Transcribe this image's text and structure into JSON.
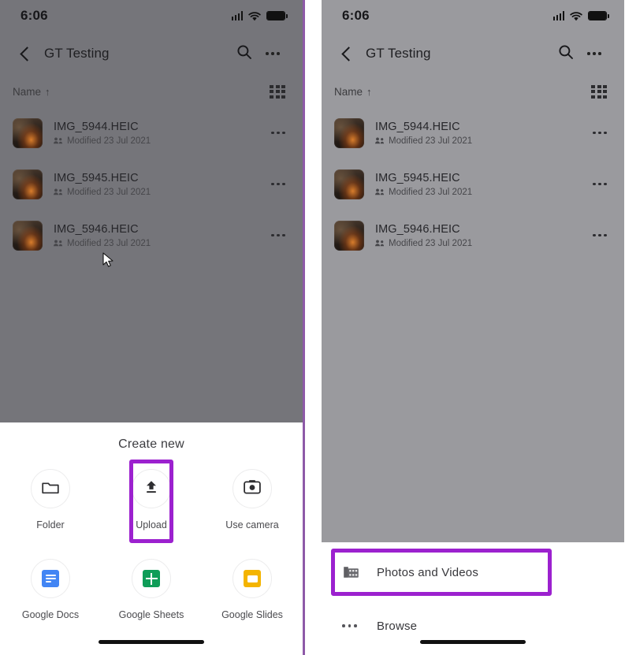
{
  "app": {
    "name": "Google Drive iOS"
  },
  "status_bar": {
    "time": "6:06",
    "icons": [
      "cellular-signal-icon",
      "wifi-icon",
      "battery-icon"
    ]
  },
  "app_bar": {
    "back_icon": "back-chevron-icon",
    "title": "GT Testing",
    "search_icon": "search-icon",
    "overflow_icon": "more-options-icon"
  },
  "sort_row": {
    "label": "Name",
    "direction_arrow": "↑",
    "view_toggle_icon": "grid-view-icon"
  },
  "files": [
    {
      "name": "IMG_5944.HEIC",
      "subtitle": "Modified 23 Jul 2021",
      "shared_icon": "shared-people-icon",
      "overflow_icon": "more-options-icon"
    },
    {
      "name": "IMG_5945.HEIC",
      "subtitle": "Modified 23 Jul 2021",
      "shared_icon": "shared-people-icon",
      "overflow_icon": "more-options-icon"
    },
    {
      "name": "IMG_5946.HEIC",
      "subtitle": "Modified 23 Jul 2021",
      "shared_icon": "shared-people-icon",
      "overflow_icon": "more-options-icon"
    }
  ],
  "left_panel": {
    "sheet": {
      "title": "Create new",
      "items": [
        {
          "label": "Folder",
          "icon": "folder-icon",
          "highlighted": false
        },
        {
          "label": "Upload",
          "icon": "upload-icon",
          "highlighted": true
        },
        {
          "label": "Use camera",
          "icon": "camera-icon",
          "highlighted": false
        },
        {
          "label": "Google Docs",
          "icon": "google-docs-icon",
          "highlighted": false
        },
        {
          "label": "Google Sheets",
          "icon": "google-sheets-icon",
          "highlighted": false
        },
        {
          "label": "Google Slides",
          "icon": "google-slides-icon",
          "highlighted": false
        }
      ]
    },
    "cursor": "mouse-pointer"
  },
  "right_panel": {
    "sheet": {
      "items": [
        {
          "label": "Photos and Videos",
          "icon": "photos-videos-icon",
          "highlighted": true
        },
        {
          "label": "Browse",
          "icon": "browse-dots-icon",
          "highlighted": false
        }
      ]
    }
  },
  "colors": {
    "highlight_purple": "#9c21cf",
    "panel_divider": "#8e5aa8",
    "left_scrim": "#75757a",
    "right_scrim": "#9a9a9e",
    "docs_blue": "#4285f4",
    "sheets_green": "#0f9d58",
    "slides_yellow": "#f4b400"
  }
}
